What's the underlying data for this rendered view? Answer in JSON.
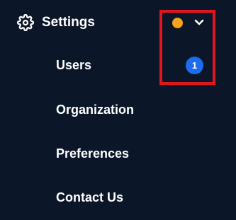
{
  "header": {
    "icon": "gear-icon",
    "label": "Settings",
    "status_dot_color": "#f5a41c",
    "expand_icon": "chevron-down-icon"
  },
  "menu": {
    "items": [
      {
        "label": "Users",
        "badge": "1"
      },
      {
        "label": "Organization"
      },
      {
        "label": "Preferences"
      },
      {
        "label": "Contact Us"
      }
    ]
  },
  "colors": {
    "background": "#0b1628",
    "text": "#ffffff",
    "badge": "#1c6cf0",
    "highlight": "#e0161f"
  }
}
